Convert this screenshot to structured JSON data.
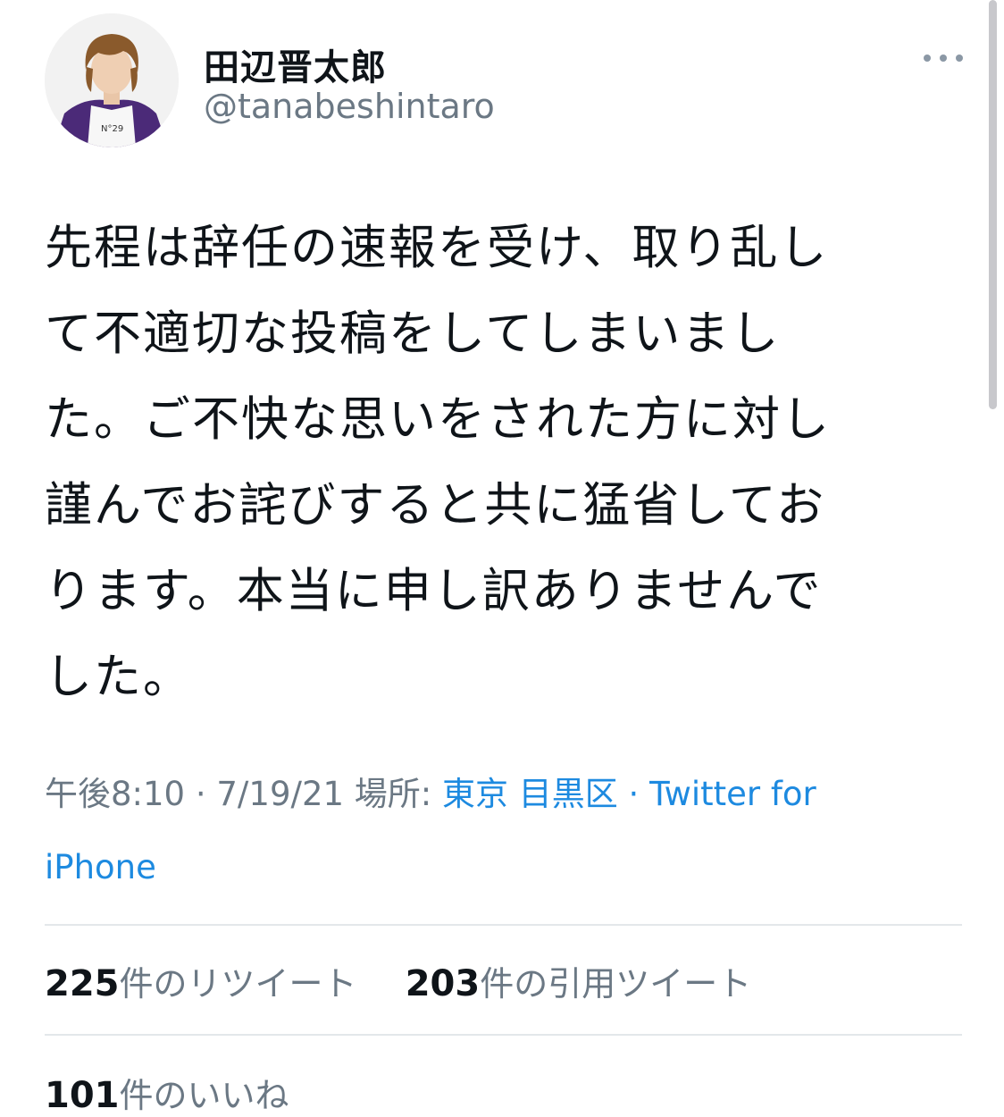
{
  "user": {
    "display_name": "田辺晋太郎",
    "handle": "@tanabeshintaro"
  },
  "menu": {
    "icon": "more-horizontal-icon"
  },
  "tweet": {
    "text": "先程は辞任の速報を受け、取り乱し\nて不適切な投稿をしてしまいまし\nた。ご不快な思いをされた方に対し\n謹んでお詫びすると共に猛省してお\nります。本当に申し訳ありませんで\nした。"
  },
  "meta": {
    "time": "午後8:10",
    "sep1": " · ",
    "date": "7/19/21",
    "location_label": " 場所: ",
    "location": "東京 目黒区",
    "sep2": " · ",
    "source": "Twitter for iPhone"
  },
  "stats": {
    "retweets_count": "225",
    "retweets_label": "件のリツイート",
    "quotes_count": "203",
    "quotes_label": "件の引用ツイート",
    "likes_count": "101",
    "likes_label": "件のいいね"
  }
}
